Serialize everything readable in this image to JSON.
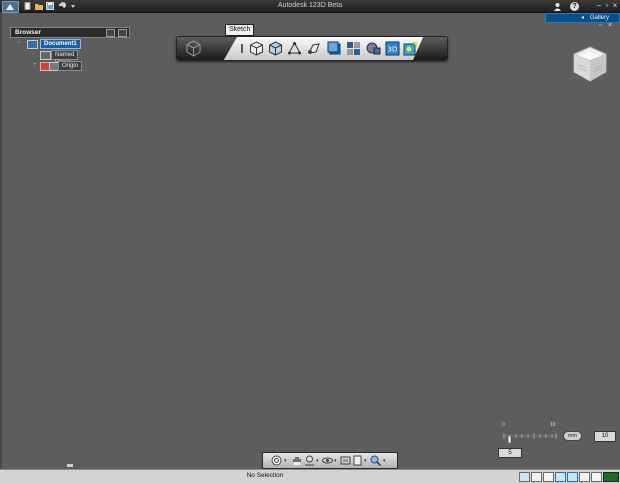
{
  "window": {
    "title": "Autodesk 123D Beta"
  },
  "header": {
    "gallery_label": "Gallery",
    "gallery_arrow": "◂",
    "help_label": "?"
  },
  "browser": {
    "title": "Browser",
    "items": [
      {
        "label": "Document1",
        "expander": "−"
      },
      {
        "label": "Named Views",
        "expander": ""
      },
      {
        "label": "Origin",
        "expander": "+"
      }
    ]
  },
  "toolbar": {
    "tooltip": "Sketch"
  },
  "scale": {
    "tick_start": "0",
    "tick_end": "10",
    "unit": "mm",
    "value": "10",
    "sub_value": "5"
  },
  "status": {
    "text": "No Selection"
  },
  "colors": {
    "viewport": "#5d5d5d",
    "accent": "#1b5fa6",
    "gallery": "#0b4f87"
  },
  "icons": {
    "toolbar": [
      "info-icon",
      "box-icon",
      "cylinder-icon",
      "cone-icon",
      "sphere-icon",
      "primitive-icon",
      "pattern-icon",
      "combine-icon",
      "grid-icon",
      "text3d-icon",
      "measure-icon"
    ],
    "navbar": [
      "steering-wheel-icon",
      "pan-icon",
      "zoom-icon",
      "orbit-icon",
      "fit-icon",
      "look-at-icon"
    ]
  }
}
